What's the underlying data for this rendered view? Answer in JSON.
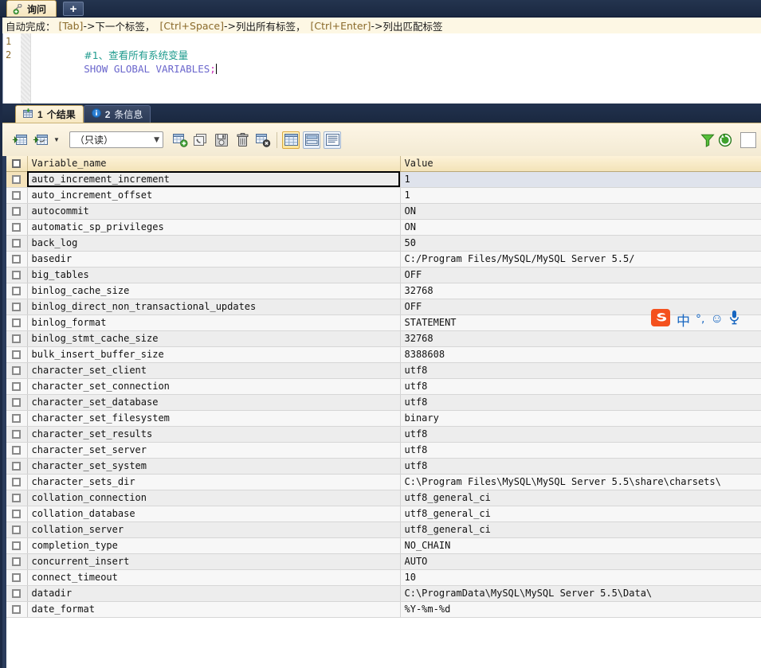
{
  "window": {
    "tab_label": "询问",
    "new_tab_label": "+"
  },
  "hint": {
    "prefix": "自动完成：",
    "items": [
      {
        "key": "[Tab]",
        "sep": "-> ",
        "text": "下一个标签，"
      },
      {
        "key": "[Ctrl+Space]",
        "sep": "-> ",
        "text": "列出所有标签，"
      },
      {
        "key": "[Ctrl+Enter]",
        "sep": "-> ",
        "text": "列出匹配标签"
      }
    ]
  },
  "editor": {
    "line_numbers": [
      "1",
      "2"
    ],
    "lines": [
      {
        "num": "1",
        "comment": "#1、查看所有系统变量"
      },
      {
        "num": "2",
        "keyword": "SHOW GLOBAL VARIABLES",
        "semi": ";"
      }
    ]
  },
  "result_tabs": [
    {
      "label": "1 个结果",
      "num": "1",
      "text": "个结果",
      "icon": "result-grid-icon",
      "active": true
    },
    {
      "label": "2 条信息",
      "num": "2",
      "text": "条信息",
      "icon": "info-icon",
      "active": false
    }
  ],
  "toolbar": {
    "readonly_select": "（只读）",
    "readonly_arrow": "⌄",
    "buttons": [
      {
        "name": "grid-insert-record-icon",
        "title": "插入记录"
      },
      {
        "name": "grid-apply-icon",
        "title": "应用"
      },
      {
        "name": "grid-dropdown-arrow-icon",
        "title": "▾"
      },
      {
        "name": "add-record-icon",
        "title": "添加记录"
      },
      {
        "name": "revert-record-icon",
        "title": "还原记录"
      },
      {
        "name": "save-record-icon",
        "title": "保存记录"
      },
      {
        "name": "delete-record-icon",
        "title": "删除记录"
      },
      {
        "name": "cancel-record-icon",
        "title": "取消记录"
      },
      {
        "name": "view-grid-icon",
        "title": "网格视图",
        "active": true
      },
      {
        "name": "view-form-icon",
        "title": "表单视图",
        "active": false
      },
      {
        "name": "view-text-icon",
        "title": "文本视图",
        "active": false
      },
      {
        "name": "filter-icon",
        "title": "筛选"
      },
      {
        "name": "refresh-icon",
        "title": "刷新"
      }
    ]
  },
  "grid": {
    "columns": [
      "Variable_name",
      "Value"
    ],
    "selected_row_index": 0,
    "rows": [
      [
        "auto_increment_increment",
        "1"
      ],
      [
        "auto_increment_offset",
        "1"
      ],
      [
        "autocommit",
        "ON"
      ],
      [
        "automatic_sp_privileges",
        "ON"
      ],
      [
        "back_log",
        "50"
      ],
      [
        "basedir",
        "C:/Program Files/MySQL/MySQL Server 5.5/"
      ],
      [
        "big_tables",
        "OFF"
      ],
      [
        "binlog_cache_size",
        "32768"
      ],
      [
        "binlog_direct_non_transactional_updates",
        "OFF"
      ],
      [
        "binlog_format",
        "STATEMENT"
      ],
      [
        "binlog_stmt_cache_size",
        "32768"
      ],
      [
        "bulk_insert_buffer_size",
        "8388608"
      ],
      [
        "character_set_client",
        "utf8"
      ],
      [
        "character_set_connection",
        "utf8"
      ],
      [
        "character_set_database",
        "utf8"
      ],
      [
        "character_set_filesystem",
        "binary"
      ],
      [
        "character_set_results",
        "utf8"
      ],
      [
        "character_set_server",
        "utf8"
      ],
      [
        "character_set_system",
        "utf8"
      ],
      [
        "character_sets_dir",
        "C:\\Program Files\\MySQL\\MySQL Server 5.5\\share\\charsets\\"
      ],
      [
        "collation_connection",
        "utf8_general_ci"
      ],
      [
        "collation_database",
        "utf8_general_ci"
      ],
      [
        "collation_server",
        "utf8_general_ci"
      ],
      [
        "completion_type",
        "NO_CHAIN"
      ],
      [
        "concurrent_insert",
        "AUTO"
      ],
      [
        "connect_timeout",
        "10"
      ],
      [
        "datadir",
        "C:\\ProgramData\\MySQL\\MySQL Server 5.5\\Data\\"
      ],
      [
        "date_format",
        "%Y-%m-%d"
      ]
    ]
  },
  "ime": {
    "logo": "S",
    "mode": "中",
    "punctuation": "°,",
    "emoji": "☺",
    "mic": "🎤"
  },
  "colors": {
    "titlebar": "#1c2a45",
    "tab_active": "#fdf4de",
    "comment": "#1f9b8e",
    "keyword": "#6a66cc",
    "semicolon": "#cc2bbb",
    "header": "#f3e3b8",
    "ime_orange": "#f4511e"
  }
}
